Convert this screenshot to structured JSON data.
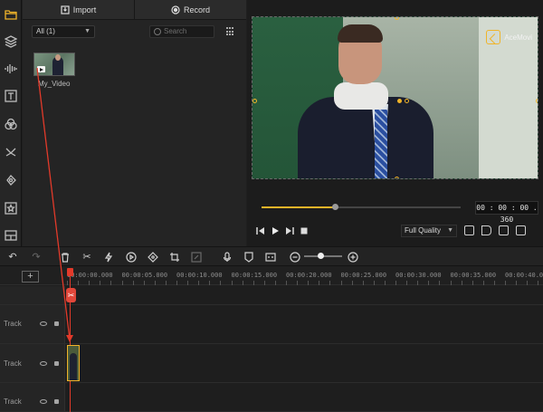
{
  "sidebar": {
    "items": [
      {
        "icon": "media-folder-icon",
        "active": true
      },
      {
        "icon": "layers-icon",
        "active": false
      },
      {
        "icon": "audio-wave-icon",
        "active": false
      },
      {
        "icon": "text-icon",
        "active": false
      },
      {
        "icon": "filters-icon",
        "active": false
      },
      {
        "icon": "transitions-icon",
        "active": false
      },
      {
        "icon": "effects-icon",
        "active": false
      },
      {
        "icon": "elements-icon",
        "active": false
      },
      {
        "icon": "split-screen-icon",
        "active": false
      }
    ]
  },
  "media": {
    "import_label": "Import",
    "record_label": "Record",
    "filter_value": "All (1)",
    "search_placeholder": "Search",
    "items": [
      {
        "name": "My_Video"
      }
    ]
  },
  "preview": {
    "watermark": "AceMovi",
    "progress": 0.37,
    "timecode": "00 : 00 : 00 . 360",
    "quality": "Full Quality"
  },
  "timeline": {
    "ruler_labels": [
      "00:00:00.000",
      "00:00:05.000",
      "00:00:10.000",
      "00:00:15.000",
      "00:00:20.000",
      "00:00:25.000",
      "00:00:30.000",
      "00:00:35.000",
      "00:00:40.000"
    ],
    "tracks": [
      {
        "name": "Track"
      },
      {
        "name": "Track"
      },
      {
        "name": "Track"
      }
    ]
  },
  "colors": {
    "accent": "#f0b429",
    "playhead": "#e23a2a"
  }
}
